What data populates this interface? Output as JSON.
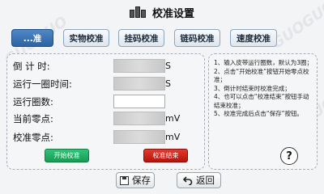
{
  "title": "校准设置",
  "tabs": [
    {
      "label": "...准"
    },
    {
      "label": "实物校准"
    },
    {
      "label": "挂码校准"
    },
    {
      "label": "链码校准"
    },
    {
      "label": "速度校准"
    }
  ],
  "form": {
    "countdown_label": "倒 计 时:",
    "countdown_unit": "S",
    "lap_time_label": "运行一圈时间:",
    "lap_time_unit": "S",
    "laps_label": "运行圈数:",
    "current_zero_label": "当前零点:",
    "current_zero_unit": "mV",
    "calib_zero_label": "校准零点:",
    "calib_zero_unit": "mV"
  },
  "buttons": {
    "start": "开始校准",
    "stop": "校准结束",
    "save": "保存",
    "back": "返回",
    "help": "?"
  },
  "instructions": [
    "1、输入皮带运行圈数，默认为3圈；",
    "2、点击“开始校准”按钮开始零点校准；",
    "3、倒计时结束时校准完成；",
    "4、也可以点击“校准结束”按钮手动结束校准；",
    "5、校准完成后点击“保存”按钮。"
  ],
  "icons": {
    "title": "settings-tools-icon",
    "save": "floppy-disk-icon",
    "back": "return-arrow-icon"
  },
  "colors": {
    "active_tab": "#2c63a3",
    "start_button": "#1b9a55",
    "stop_button": "#b4140c"
  }
}
